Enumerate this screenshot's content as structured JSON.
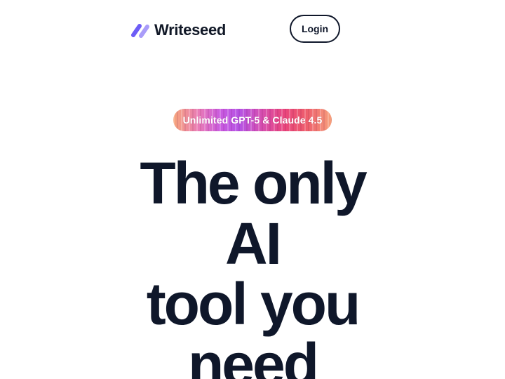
{
  "header": {
    "logo_text": "Writeseed",
    "logo_icon": "double-slash-logo-icon",
    "login_label": "Login"
  },
  "hero": {
    "badge_text": "Unlimited GPT-5 & Claude 4.5",
    "headline_lines": [
      "The only",
      "AI",
      "tool you",
      "need"
    ]
  },
  "colors": {
    "text": "#0f172a",
    "brand_purple": "#6d5df6",
    "brand_purple_light": "#a99cf9",
    "background": "#ffffff"
  }
}
